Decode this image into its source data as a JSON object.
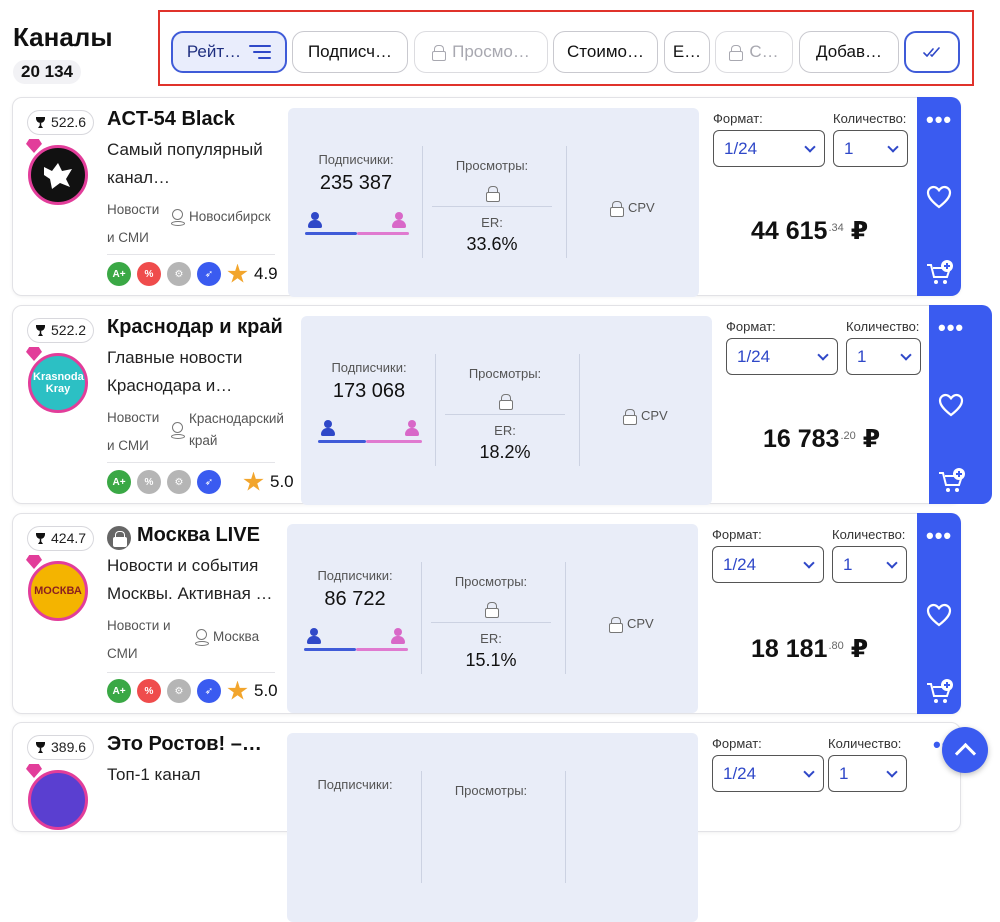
{
  "header": {
    "title": "Каналы",
    "count": "20 134"
  },
  "filters": [
    {
      "label": "Рейт…",
      "state": "active",
      "icon": "sort-icon"
    },
    {
      "label": "Подписч…",
      "state": "normal"
    },
    {
      "label": "Просмо…",
      "state": "locked",
      "icon": "lock-icon"
    },
    {
      "label": "Стоимо…",
      "state": "normal"
    },
    {
      "label": "E…",
      "state": "normal"
    },
    {
      "label": "С…",
      "state": "locked",
      "icon": "lock-icon"
    },
    {
      "label": "Добав…",
      "state": "normal"
    },
    {
      "label": "",
      "state": "apply",
      "icon": "double-check-icon"
    }
  ],
  "labels": {
    "subscribers": "Подписчики:",
    "views": "Просмотры:",
    "er": "ER:",
    "cpv": "CPV",
    "format": "Формат:",
    "quantity": "Количество:",
    "currency": "₽"
  },
  "channels": [
    {
      "rating": "522.6",
      "name": "ACT-54 Black",
      "desc": "Самый популярный канал…",
      "category": "Новости и СМИ",
      "city": "Новосибирск",
      "subscribers": "235 387",
      "er": "33.6%",
      "format": "1/24",
      "qty": "1",
      "price_main": "44 615",
      "price_cents": ".34",
      "stars": "4.9",
      "badges": [
        "A+",
        "%",
        "bot",
        "rocket"
      ],
      "badge_colors": [
        "#3aa845",
        "#ef4c4c",
        "#b5b5b5",
        "#3a5bf0"
      ],
      "male_share": 0.5
    },
    {
      "rating": "522.2",
      "name": "Краснодар и край",
      "desc": "Главные новости Краснодара и…",
      "category": "Новости и СМИ",
      "city": "Краснодарский край",
      "subscribers": "173 068",
      "er": "18.2%",
      "format": "1/24",
      "qty": "1",
      "price_main": "16 783",
      "price_cents": ".20",
      "stars": "5.0",
      "badges": [
        "A+",
        "%",
        "bot",
        "rocket"
      ],
      "badge_colors": [
        "#3aa845",
        "#b5b5b5",
        "#b5b5b5",
        "#3a5bf0"
      ],
      "male_share": 0.47
    },
    {
      "rating": "424.7",
      "name": "Москва LIVE",
      "desc": "Новости и события Москвы. Активная …",
      "category": "Новости и СМИ",
      "city": "Москва",
      "subscribers": "86 722",
      "er": "15.1%",
      "format": "1/24",
      "qty": "1",
      "price_main": "18 181",
      "price_cents": ".80",
      "stars": "5.0",
      "badges": [
        "A+",
        "%",
        "bot",
        "rocket"
      ],
      "badge_colors": [
        "#3aa845",
        "#ef4c4c",
        "#b5b5b5",
        "#3a5bf0"
      ],
      "male_share": 0.5,
      "locked": true
    },
    {
      "rating": "389.6",
      "name": "Это Ростов! –…",
      "desc": "Топ-1 канал",
      "format": "1/24",
      "qty": "1"
    }
  ],
  "avatars": [
    {
      "text": "",
      "bg": "#111111"
    },
    {
      "text": "Krasnodar Kray",
      "bg": "#2cc0c4"
    },
    {
      "text": "МОСКВА",
      "bg": "#f4b400"
    },
    {
      "text": "",
      "bg": "#5a3fd0"
    }
  ]
}
